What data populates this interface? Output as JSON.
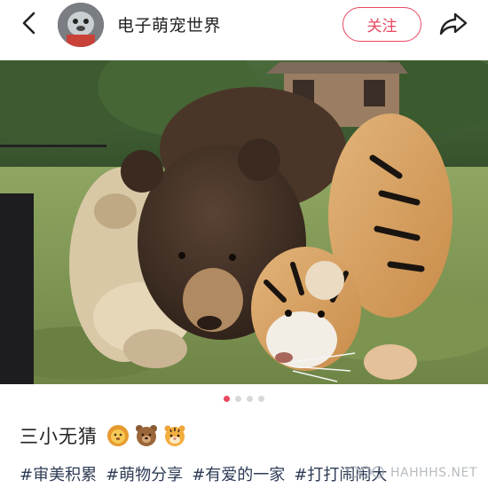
{
  "header": {
    "back_icon": "chevron-left-icon",
    "account_name": "电子萌宠世界",
    "follow_label": "关注",
    "share_icon": "share-arrow-icon",
    "accent_color": "#e8475f"
  },
  "photo": {
    "subject": "lion-bear-tiger-photo"
  },
  "carousel": {
    "total": 4,
    "active_index": 0
  },
  "post": {
    "title": "三小无猜",
    "emojis": [
      "lion-emoji",
      "bear-emoji",
      "tiger-emoji"
    ],
    "hashtags": [
      "#审美积累",
      "#萌物分享",
      "#有爱的一家",
      "#打打闹闹大"
    ]
  },
  "watermark": {
    "text": "HAHHHS.NET"
  }
}
